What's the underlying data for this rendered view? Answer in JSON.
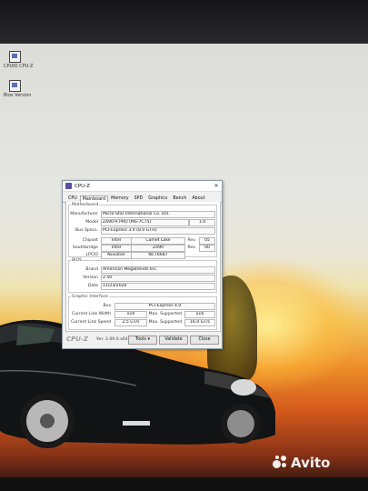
{
  "desktop": {
    "icons": [
      {
        "label": "CPUID CPU-Z"
      },
      {
        "label": "Bios Version"
      }
    ]
  },
  "window": {
    "title": "CPU-Z",
    "tabs": [
      "CPU",
      "Mainboard",
      "Memory",
      "SPD",
      "Graphics",
      "Bench",
      "About"
    ],
    "active_tab": "Mainboard",
    "motherboard": {
      "legend": "Motherboard",
      "manufacturer_label": "Manufacturer",
      "manufacturer": "Micro-Star International Co. Ltd.",
      "model_label": "Model",
      "model": "Z490-A PRO (MS-7C75)",
      "model_rev": "1.0",
      "bus_specs_label": "Bus Specs.",
      "bus_specs": "PCI-Express 3.0 (8.0 GT/s)",
      "chipset_label": "Chipset",
      "chipset_vendor": "Intel",
      "chipset_name": "Comet Lake",
      "chipset_rev_label": "Rev.",
      "chipset_rev": "05",
      "southbridge_label": "Southbridge",
      "southbridge_vendor": "Intel",
      "southbridge_name": "Z490",
      "southbridge_rev_label": "Rev.",
      "southbridge_rev": "00",
      "lpcio_label": "LPCIO",
      "lpcio_vendor": "Nuvoton",
      "lpcio_name": "NCT6687"
    },
    "bios": {
      "legend": "BIOS",
      "brand_label": "Brand",
      "brand": "American Megatrends Inc.",
      "version_label": "Version",
      "version": "2.50",
      "date_label": "Date",
      "date": "11/23/2020"
    },
    "graphic_interface": {
      "legend": "Graphic Interface",
      "bus_label": "Bus",
      "bus": "PCI-Express 4.0",
      "link_width_label": "Current Link Width",
      "link_width": "x16",
      "max_width_label": "Max. Supported",
      "max_width": "x16",
      "link_speed_label": "Current Link Speed",
      "link_speed": "2.5 GT/s",
      "max_speed_label": "Max. Supported",
      "max_speed": "16.0 GT/s"
    },
    "footer": {
      "brand": "CPU-Z",
      "version": "Ver. 2.09.0.x64",
      "tools_label": "Tools",
      "validate_label": "Validate",
      "close_label": "Close"
    }
  },
  "watermark": "Avito"
}
